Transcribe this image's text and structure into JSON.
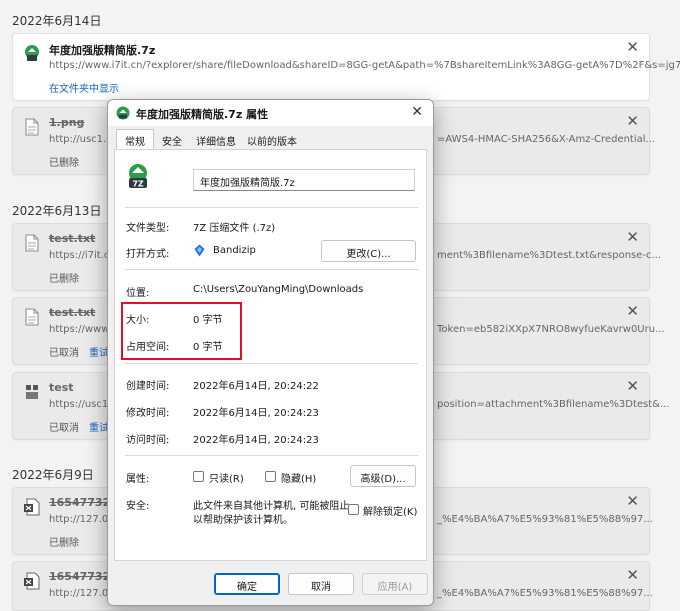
{
  "downloads": {
    "groups": [
      {
        "date": "2022年6月14日"
      },
      {
        "date": "2022年6月13日"
      },
      {
        "date": "2022年6月9日"
      }
    ],
    "items": [
      {
        "name": "年度加强版精简版.7z",
        "url": "https://www.i7it.cn/?explorer/share/fileDownload&shareID=8GG-getA&path=%7BshareItemLink%3A8GG-getA%7D%2F&s=jg7Zv",
        "action": "在文件夹中显示"
      },
      {
        "name": "1.png",
        "url": "http://usc1.co",
        "url_tail": "=AWS4-HMAC-SHA256&X-Amz-Credential...",
        "status": "已删除"
      },
      {
        "name": "test.txt",
        "url": "https://i7it.oss-",
        "url_tail": "ment%3Bfilename%3Dtest.txt&response-c...",
        "status": "已删除"
      },
      {
        "name": "test.txt",
        "url": "https://www.i7it",
        "url_tail": "Token=eb582iXXpX7NRO8wyfueKavrw0Uru...",
        "status": "已取消",
        "retry": "重试"
      },
      {
        "name": "test",
        "url": "https://usc1.co",
        "url_tail": "position=attachment%3Bfilename%3Dtest&...",
        "status": "已取消",
        "retry": "重试"
      },
      {
        "name": "16547732351",
        "url": "http://127.0.0.",
        "url_tail": "_%E4%BA%A7%E5%93%81%E5%88%97...",
        "status": "已删除"
      },
      {
        "name": "16547732170",
        "url": "http://127.0.0.",
        "url_tail": "_%E4%BA%A7%E5%93%81%E5%88%97..."
      }
    ],
    "close_glyph": "✕"
  },
  "dialog": {
    "title": "年度加强版精简版.7z 属性",
    "close_glyph": "✕",
    "tabs": [
      "常规",
      "安全",
      "详细信息",
      "以前的版本"
    ],
    "filename": "年度加强版精简版.7z",
    "icon_text": "7Z",
    "rows": {
      "type_label": "文件类型:",
      "type_value": "7Z 压缩文件 (.7z)",
      "open_label": "打开方式:",
      "open_value": "Bandizip",
      "change_button": "更改(C)...",
      "location_label": "位置:",
      "location_value": "C:\\Users\\ZouYangMing\\Downloads",
      "size_label": "大小:",
      "size_value": "0 字节",
      "disk_label": "占用空间:",
      "disk_value": "0 字节",
      "created_label": "创建时间:",
      "created_value": "2022年6月14日, 20:24:22",
      "modified_label": "修改时间:",
      "modified_value": "2022年6月14日, 20:24:23",
      "accessed_label": "访问时间:",
      "accessed_value": "2022年6月14日, 20:24:23",
      "attr_label": "属性:",
      "readonly_label": "只读(R)",
      "hidden_label": "隐藏(H)",
      "advanced_button": "高级(D)...",
      "security_label": "安全:",
      "security_text_1": "此文件来自其他计算机, 可能被阻止",
      "security_text_2": "以帮助保护该计算机。",
      "unblock_label": "解除锁定(K)"
    },
    "buttons": {
      "ok": "确定",
      "cancel": "取消",
      "apply": "应用(A)"
    }
  },
  "colors": {
    "accent": "#0067c0",
    "highlight_box": "#e0102a",
    "zip_green": "#2a9d4a"
  }
}
